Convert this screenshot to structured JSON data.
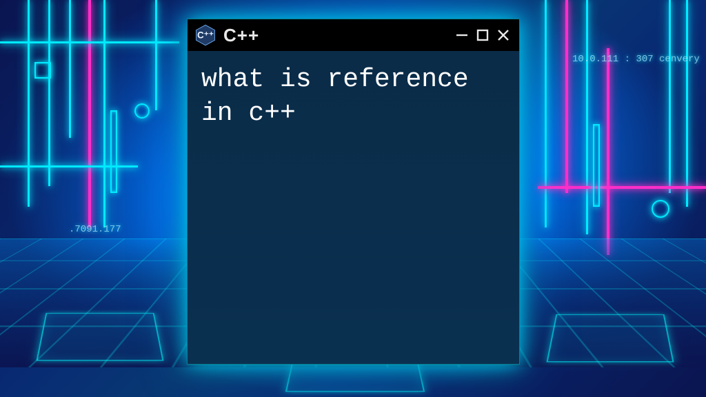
{
  "window": {
    "title": "C++",
    "icon_name": "cpp-hex-logo-icon",
    "controls": {
      "minimize": "−",
      "maximize": "□",
      "close": "✕"
    },
    "body_text": "what is reference in c++"
  },
  "background": {
    "decor_text_left": ".7091.177",
    "decor_text_right": "10.0.111 : 307  cenvery"
  },
  "colors": {
    "window_bg": "#0b2e4a",
    "titlebar_bg": "#000000",
    "text": "#ffffff",
    "neon_cyan": "#00eaff",
    "neon_pink": "#ff2ec9"
  }
}
